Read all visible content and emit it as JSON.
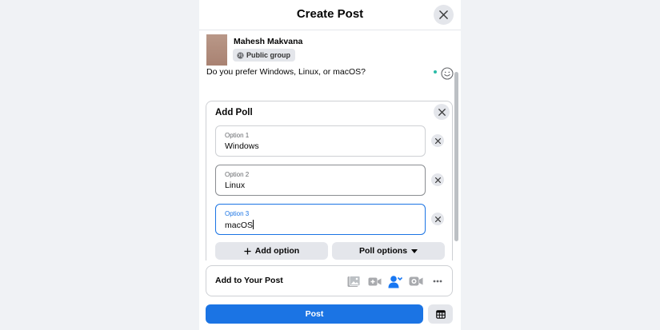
{
  "dialog": {
    "title": "Create Post"
  },
  "user": {
    "name": "Mahesh Makvana",
    "audience": "Public group"
  },
  "composer": {
    "text": "Do you prefer Windows, Linux, or macOS?"
  },
  "poll": {
    "title": "Add Poll",
    "options": [
      {
        "label": "Option 1",
        "value": "Windows"
      },
      {
        "label": "Option 2",
        "value": "Linux"
      },
      {
        "label": "Option 3",
        "value": "macOS"
      }
    ],
    "add_option_label": "Add option",
    "poll_options_label": "Poll options"
  },
  "add_to_post": {
    "label": "Add to Your Post",
    "icons": [
      "photo-video-icon",
      "live-video-icon",
      "tag-people-icon",
      "video-room-icon",
      "more-icon"
    ]
  },
  "footer": {
    "post_label": "Post"
  },
  "colors": {
    "accent": "#1b74e4",
    "tag_people": "#1877f2",
    "online_dot": "#2abba7",
    "chip_background": "#e4e6eb"
  }
}
